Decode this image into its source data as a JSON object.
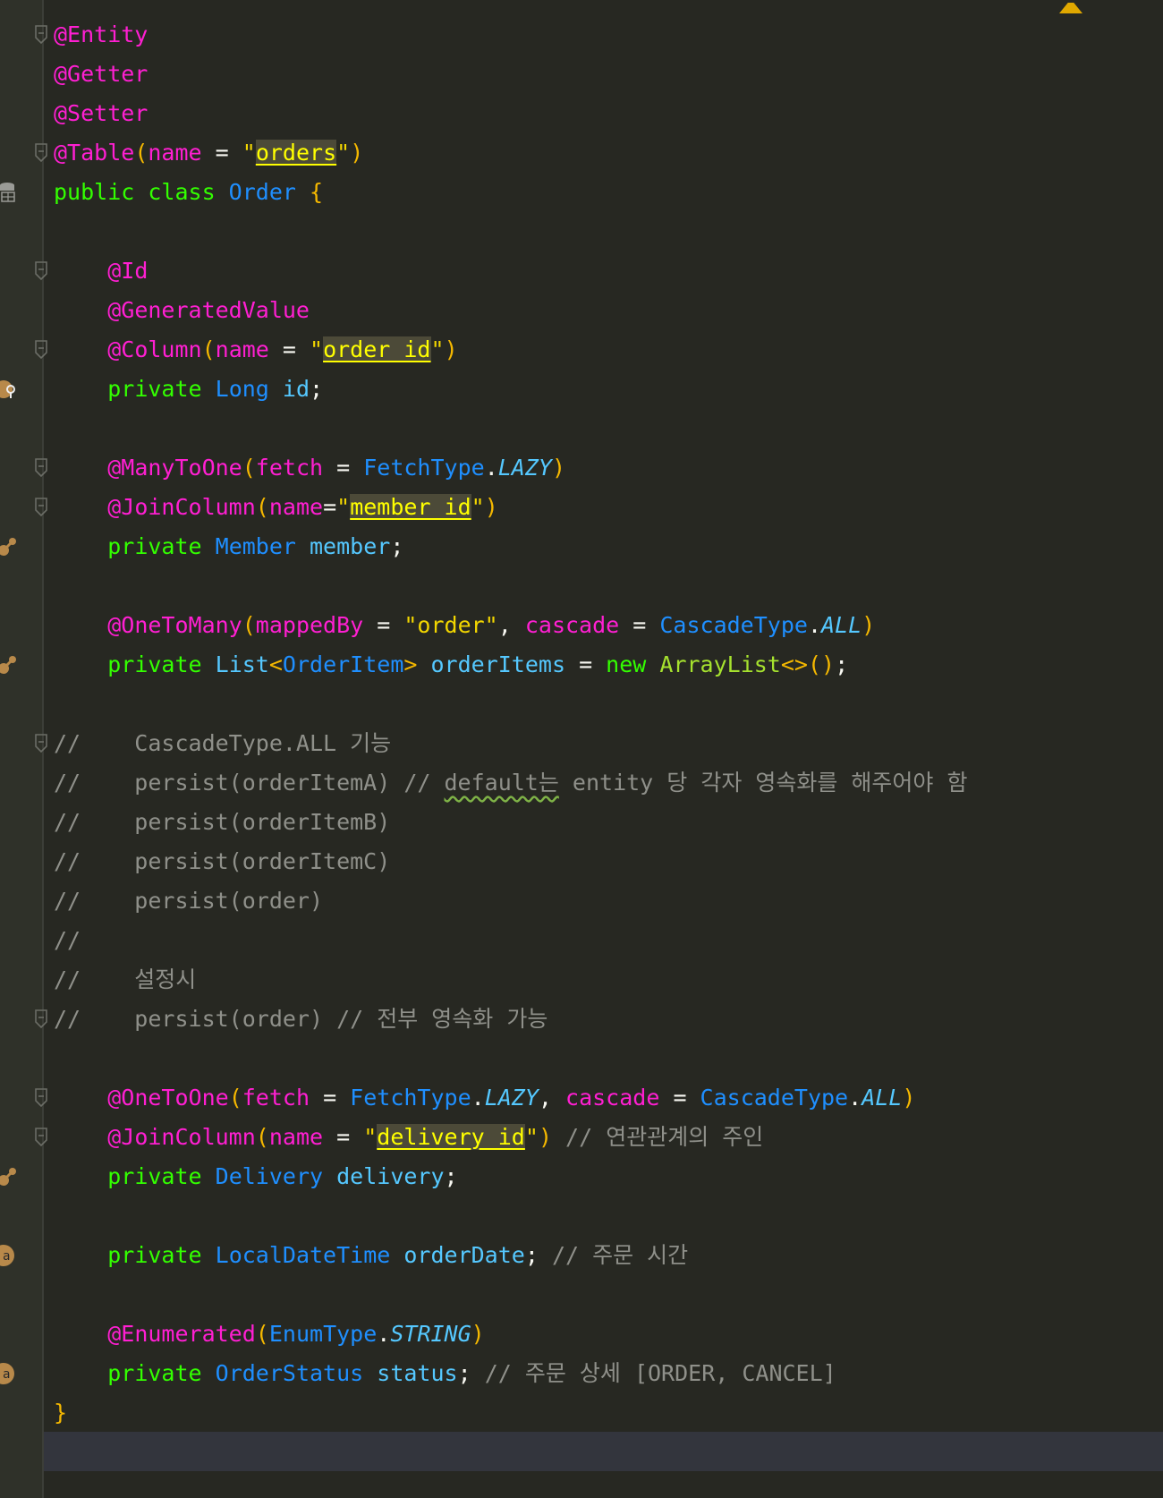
{
  "lines": [
    {
      "tokens": [
        {
          "t": "@Entity",
          "c": "ann"
        }
      ],
      "fold": true
    },
    {
      "tokens": [
        {
          "t": "@Getter",
          "c": "ann"
        }
      ]
    },
    {
      "tokens": [
        {
          "t": "@Setter",
          "c": "ann"
        }
      ]
    },
    {
      "tokens": [
        {
          "t": "@Table",
          "c": "ann"
        },
        {
          "t": "(",
          "c": "par"
        },
        {
          "t": "name",
          "c": "ann"
        },
        {
          "t": " = ",
          "c": "plain"
        },
        {
          "t": "\"",
          "c": "str"
        },
        {
          "t": "orders",
          "c": "hl"
        },
        {
          "t": "\"",
          "c": "str"
        },
        {
          "t": ")",
          "c": "par"
        }
      ],
      "fold": true
    },
    {
      "tokens": [
        {
          "t": "public class ",
          "c": "kw"
        },
        {
          "t": "Order ",
          "c": "type"
        },
        {
          "t": "{",
          "c": "par"
        }
      ],
      "gutter": "db-icon"
    },
    {
      "tokens": []
    },
    {
      "tokens": [
        {
          "t": "    ",
          "c": "plain"
        },
        {
          "t": "@Id",
          "c": "ann"
        }
      ],
      "fold": true
    },
    {
      "tokens": [
        {
          "t": "    ",
          "c": "plain"
        },
        {
          "t": "@GeneratedValue",
          "c": "ann"
        }
      ]
    },
    {
      "tokens": [
        {
          "t": "    ",
          "c": "plain"
        },
        {
          "t": "@Column",
          "c": "ann"
        },
        {
          "t": "(",
          "c": "par"
        },
        {
          "t": "name",
          "c": "ann"
        },
        {
          "t": " = ",
          "c": "plain"
        },
        {
          "t": "\"",
          "c": "str"
        },
        {
          "t": "order_id",
          "c": "hl"
        },
        {
          "t": "\"",
          "c": "str"
        },
        {
          "t": ")",
          "c": "par"
        }
      ],
      "fold": true
    },
    {
      "tokens": [
        {
          "t": "    ",
          "c": "plain"
        },
        {
          "t": "private ",
          "c": "kw"
        },
        {
          "t": "Long ",
          "c": "type"
        },
        {
          "t": "id",
          "c": "fld"
        },
        {
          "t": ";",
          "c": "plain"
        }
      ],
      "gutter": "key-icon"
    },
    {
      "tokens": []
    },
    {
      "tokens": [
        {
          "t": "    ",
          "c": "plain"
        },
        {
          "t": "@ManyToOne",
          "c": "ann"
        },
        {
          "t": "(",
          "c": "par"
        },
        {
          "t": "fetch",
          "c": "ann"
        },
        {
          "t": " = ",
          "c": "plain"
        },
        {
          "t": "FetchType",
          "c": "type"
        },
        {
          "t": ".",
          "c": "plain"
        },
        {
          "t": "LAZY",
          "c": "const"
        },
        {
          "t": ")",
          "c": "par"
        }
      ],
      "fold": true
    },
    {
      "tokens": [
        {
          "t": "    ",
          "c": "plain"
        },
        {
          "t": "@JoinColumn",
          "c": "ann"
        },
        {
          "t": "(",
          "c": "par"
        },
        {
          "t": "name",
          "c": "ann"
        },
        {
          "t": "=",
          "c": "plain"
        },
        {
          "t": "\"",
          "c": "str"
        },
        {
          "t": "member_id",
          "c": "hl"
        },
        {
          "t": "\"",
          "c": "str"
        },
        {
          "t": ")",
          "c": "par"
        }
      ],
      "fold": true
    },
    {
      "tokens": [
        {
          "t": "    ",
          "c": "plain"
        },
        {
          "t": "private ",
          "c": "kw"
        },
        {
          "t": "Member ",
          "c": "type"
        },
        {
          "t": "member",
          "c": "fld"
        },
        {
          "t": ";",
          "c": "plain"
        }
      ],
      "gutter": "relation-icon"
    },
    {
      "tokens": []
    },
    {
      "tokens": [
        {
          "t": "    ",
          "c": "plain"
        },
        {
          "t": "@OneToMany",
          "c": "ann"
        },
        {
          "t": "(",
          "c": "par"
        },
        {
          "t": "mappedBy",
          "c": "ann"
        },
        {
          "t": " = ",
          "c": "plain"
        },
        {
          "t": "\"order\"",
          "c": "str"
        },
        {
          "t": ", ",
          "c": "plain"
        },
        {
          "t": "cascade",
          "c": "ann"
        },
        {
          "t": " = ",
          "c": "plain"
        },
        {
          "t": "CascadeType",
          "c": "type"
        },
        {
          "t": ".",
          "c": "plain"
        },
        {
          "t": "ALL",
          "c": "const"
        },
        {
          "t": ")",
          "c": "par"
        }
      ]
    },
    {
      "tokens": [
        {
          "t": "    ",
          "c": "plain"
        },
        {
          "t": "private ",
          "c": "kw"
        },
        {
          "t": "List",
          "c": "fld"
        },
        {
          "t": "<",
          "c": "par"
        },
        {
          "t": "OrderItem",
          "c": "type"
        },
        {
          "t": "> ",
          "c": "par"
        },
        {
          "t": "orderItems",
          "c": "fld"
        },
        {
          "t": " = ",
          "c": "plain"
        },
        {
          "t": "new ",
          "c": "kw"
        },
        {
          "t": "ArrayList",
          "c": "fn"
        },
        {
          "t": "<>()",
          "c": "par"
        },
        {
          "t": ";",
          "c": "plain"
        }
      ],
      "gutter": "relation-icon"
    },
    {
      "tokens": []
    },
    {
      "tokens": [
        {
          "t": "//    CascadeType.ALL 기능",
          "c": "cmt"
        }
      ],
      "fold": true
    },
    {
      "tokens": [
        {
          "t": "//    persist(orderItemA) // ",
          "c": "cmt"
        },
        {
          "t": "default는",
          "c": "cmt squig"
        },
        {
          "t": " entity 당 각자 영속화를 해주어야 함",
          "c": "cmt"
        }
      ]
    },
    {
      "tokens": [
        {
          "t": "//    persist(orderItemB)",
          "c": "cmt"
        }
      ]
    },
    {
      "tokens": [
        {
          "t": "//    persist(orderItemC)",
          "c": "cmt"
        }
      ]
    },
    {
      "tokens": [
        {
          "t": "//    persist(order)",
          "c": "cmt"
        }
      ]
    },
    {
      "tokens": [
        {
          "t": "//",
          "c": "cmt"
        }
      ]
    },
    {
      "tokens": [
        {
          "t": "//    설정시",
          "c": "cmt"
        }
      ]
    },
    {
      "tokens": [
        {
          "t": "//    persist(order) // 전부 영속화 가능",
          "c": "cmt"
        }
      ],
      "fold": true
    },
    {
      "tokens": []
    },
    {
      "tokens": [
        {
          "t": "    ",
          "c": "plain"
        },
        {
          "t": "@OneToOne",
          "c": "ann"
        },
        {
          "t": "(",
          "c": "par"
        },
        {
          "t": "fetch",
          "c": "ann"
        },
        {
          "t": " = ",
          "c": "plain"
        },
        {
          "t": "FetchType",
          "c": "type"
        },
        {
          "t": ".",
          "c": "plain"
        },
        {
          "t": "LAZY",
          "c": "const"
        },
        {
          "t": ", ",
          "c": "plain"
        },
        {
          "t": "cascade",
          "c": "ann"
        },
        {
          "t": " = ",
          "c": "plain"
        },
        {
          "t": "CascadeType",
          "c": "type"
        },
        {
          "t": ".",
          "c": "plain"
        },
        {
          "t": "ALL",
          "c": "const"
        },
        {
          "t": ")",
          "c": "par"
        }
      ],
      "fold": true
    },
    {
      "tokens": [
        {
          "t": "    ",
          "c": "plain"
        },
        {
          "t": "@JoinColumn",
          "c": "ann"
        },
        {
          "t": "(",
          "c": "par"
        },
        {
          "t": "name",
          "c": "ann"
        },
        {
          "t": " = ",
          "c": "plain"
        },
        {
          "t": "\"",
          "c": "str"
        },
        {
          "t": "delivery_id",
          "c": "hl"
        },
        {
          "t": "\"",
          "c": "str"
        },
        {
          "t": ")",
          "c": "par"
        },
        {
          "t": " // 연관관계의 주인",
          "c": "cmt"
        }
      ],
      "fold": true
    },
    {
      "tokens": [
        {
          "t": "    ",
          "c": "plain"
        },
        {
          "t": "private ",
          "c": "kw"
        },
        {
          "t": "Delivery ",
          "c": "type"
        },
        {
          "t": "delivery",
          "c": "fld"
        },
        {
          "t": ";",
          "c": "plain"
        }
      ],
      "gutter": "relation-icon"
    },
    {
      "tokens": []
    },
    {
      "tokens": [
        {
          "t": "    ",
          "c": "plain"
        },
        {
          "t": "private ",
          "c": "kw"
        },
        {
          "t": "LocalDateTime ",
          "c": "type"
        },
        {
          "t": "orderDate",
          "c": "fld"
        },
        {
          "t": "; ",
          "c": "plain"
        },
        {
          "t": "// 주문 시간",
          "c": "cmt"
        }
      ],
      "gutter": "attribute-icon"
    },
    {
      "tokens": []
    },
    {
      "tokens": [
        {
          "t": "    ",
          "c": "plain"
        },
        {
          "t": "@Enumerated",
          "c": "ann"
        },
        {
          "t": "(",
          "c": "par"
        },
        {
          "t": "EnumType",
          "c": "type"
        },
        {
          "t": ".",
          "c": "plain"
        },
        {
          "t": "STRING",
          "c": "const"
        },
        {
          "t": ")",
          "c": "par"
        }
      ]
    },
    {
      "tokens": [
        {
          "t": "    ",
          "c": "plain"
        },
        {
          "t": "private ",
          "c": "kw"
        },
        {
          "t": "OrderStatus ",
          "c": "type"
        },
        {
          "t": "status",
          "c": "fld"
        },
        {
          "t": "; ",
          "c": "plain"
        },
        {
          "t": "// 주문 상세 [ORDER, CANCEL]",
          "c": "cmt"
        }
      ],
      "gutter": "attribute-icon"
    },
    {
      "tokens": [
        {
          "t": "}",
          "c": "par"
        }
      ]
    },
    {
      "tokens": []
    }
  ]
}
